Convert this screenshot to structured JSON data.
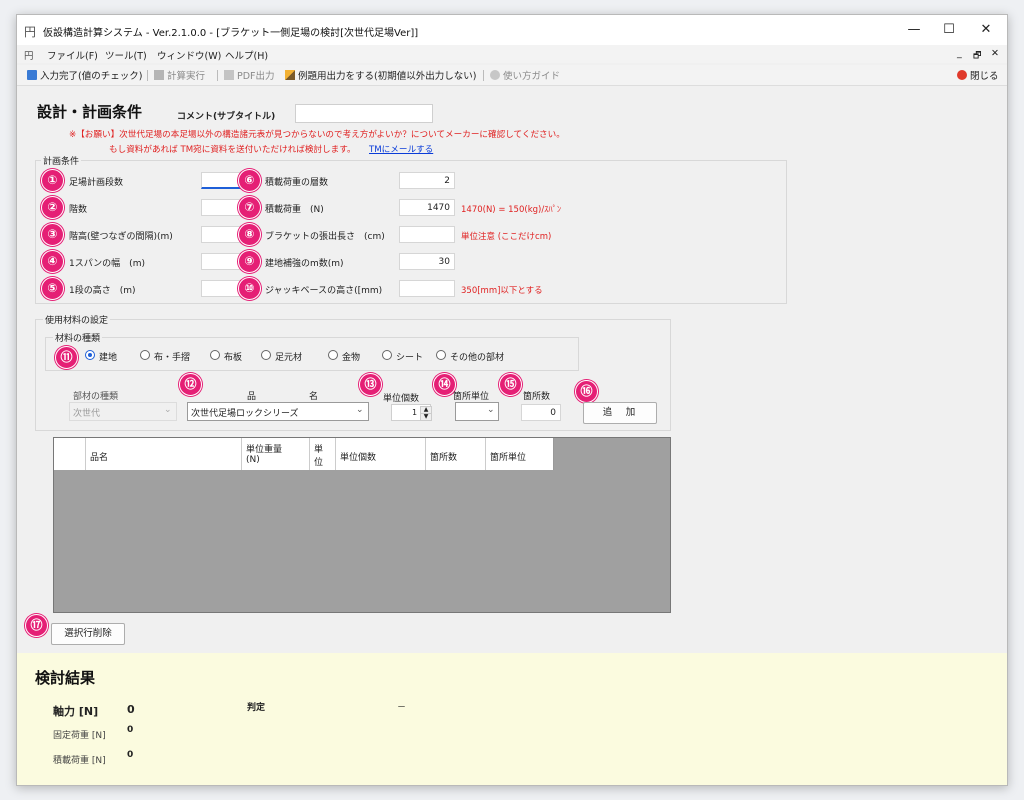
{
  "window": {
    "title": "仮設構造計算システム - Ver.2.1.0.0 - [ブラケット一側足場の検討[次世代足場Ver]]",
    "controls": {
      "minimize": "—",
      "maximize": "☐",
      "close": "✕"
    },
    "mdi_controls": {
      "minimize": "_",
      "restore": "🗗",
      "close": "✕"
    }
  },
  "menu": [
    "ファイル(F)",
    "ツール(T)",
    "ウィンドウ(W)",
    "ヘルプ(H)"
  ],
  "toolbar": {
    "input_done": "入力完了(値のチェック)",
    "calc": "計算実行",
    "pdf": "PDF出力",
    "example_output": "例題用出力をする(初期値以外出力しない)",
    "howto": "使い方ガイド",
    "close": "閉じる"
  },
  "header": {
    "title": "設計・計画条件",
    "comment_label": "コメント(サブタイトル)",
    "comment_value": "",
    "notice_line1": "※【お願い】次世代足場の本足場以外の構造諸元表が見つからないので考え方がよいか？についてメーカーに確認してください。",
    "notice_line2": "もし資料があれば TM宛に資料を送付いただければ検討します。",
    "mail_link": "TMにメールする"
  },
  "plan": {
    "group_title": "計画条件",
    "left": [
      {
        "num": "①",
        "label": "足場計画段数",
        "value": ""
      },
      {
        "num": "②",
        "label": "階数",
        "value": ""
      },
      {
        "num": "③",
        "label": "階高(壁つなぎの間隔)(m)",
        "value": ""
      },
      {
        "num": "④",
        "label": "1スパンの幅　(m)",
        "value": ""
      },
      {
        "num": "⑤",
        "label": "1段の高さ　(m)",
        "value": ""
      }
    ],
    "right": [
      {
        "num": "⑥",
        "label": "積載荷重の層数",
        "value": "2",
        "note": ""
      },
      {
        "num": "⑦",
        "label": "積載荷重　(N)",
        "value": "1470",
        "note": "1470(N) = 150(kg)/ｽﾊﾟﾝ"
      },
      {
        "num": "⑧",
        "label": "ブラケットの張出長さ　(cm)",
        "value": "",
        "note": "単位注意 (ここだけcm)"
      },
      {
        "num": "⑨",
        "label": "建地補強のm数(m)",
        "value": "30",
        "note": ""
      },
      {
        "num": "⑩",
        "label": "ジャッキベースの高さ([mm)",
        "value": "",
        "note": "350[mm]以下とする"
      }
    ]
  },
  "materials": {
    "group_title": "使用材料の設定",
    "kind_title": "材料の種類",
    "num": "⑪",
    "radios": [
      "建地",
      "布・手摺",
      "布板",
      "足元材",
      "金物",
      "シート",
      "その他の部材"
    ],
    "selected": 0,
    "part_kind_label": "部材の種類",
    "part_kind_value": "次世代",
    "name_label_1": "品",
    "name_label_2": "名",
    "name_value": "次世代足場ロックシリーズ",
    "unit_count_label": "単位個数",
    "unit_count_value": "1",
    "place_unit_label": "箇所単位",
    "place_unit_value": "",
    "place_count_label": "箇所数",
    "place_count_value": "0",
    "add_button": "追　加",
    "nums": {
      "name": "⑫",
      "unit_count": "⑬",
      "place_unit": "⑭",
      "place_count": "⑮",
      "add": "⑯"
    }
  },
  "table": {
    "columns": [
      "品名",
      "単位重量\n(N)",
      "単\n位",
      "単位個数",
      "箇所数",
      "箇所単位"
    ],
    "rows": []
  },
  "delete_row": {
    "num": "⑰",
    "label": "選択行削除"
  },
  "result": {
    "title": "検討結果",
    "axial_label": "軸力 [N]",
    "axial_value": "0",
    "judge_label": "判定",
    "judge_value": "－",
    "dead_load_label": "固定荷重 [N]",
    "dead_load_value": "0",
    "live_load_label": "積載荷重 [N]",
    "live_load_value": "0"
  },
  "colors": {
    "accent_badge": "#e51f75",
    "warning_text": "#e02020",
    "result_bg": "#fbfbdf",
    "focus": "#1e5fd8"
  }
}
